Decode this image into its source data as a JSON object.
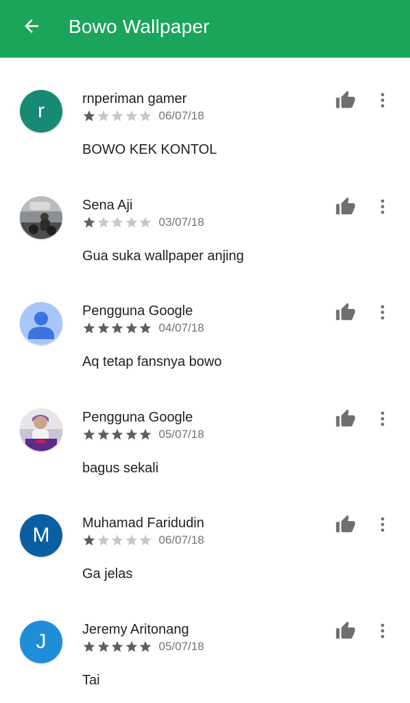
{
  "appbar": {
    "title": "Bowo Wallpaper",
    "back_icon": "arrow-back-icon",
    "color": "#1aa55b"
  },
  "reviews": [
    {
      "author": "rnperiman gamer",
      "date": "06/07/18",
      "rating": 1,
      "text": "BOWO KEK KONTOL",
      "avatar": {
        "type": "letter",
        "letter": "r",
        "color": "#178a73"
      }
    },
    {
      "author": "Sena Aji",
      "date": "03/07/18",
      "rating": 1,
      "text": "Gua suka wallpaper anjing",
      "avatar": {
        "type": "photo",
        "description": "street photo"
      }
    },
    {
      "author": "Pengguna Google",
      "date": "04/07/18",
      "rating": 5,
      "text": "Aq tetap fansnya bowo",
      "avatar": {
        "type": "default-person",
        "color": "#a8c6fa"
      }
    },
    {
      "author": "Pengguna Google",
      "date": "05/07/18",
      "rating": 5,
      "text": "bagus sekali",
      "avatar": {
        "type": "photo",
        "description": "person photo"
      }
    },
    {
      "author": "Muhamad Faridudin",
      "date": "06/07/18",
      "rating": 1,
      "text": "Ga jelas",
      "avatar": {
        "type": "letter",
        "letter": "M",
        "color": "#0b5ea3"
      }
    },
    {
      "author": "Jeremy Aritonang",
      "date": "05/07/18",
      "rating": 5,
      "text": "Tai",
      "avatar": {
        "type": "letter",
        "letter": "J",
        "color": "#1e8ed9"
      }
    }
  ],
  "icons": {
    "thumb": "thumb-up-icon",
    "more": "more-vert-icon",
    "star": "star-icon"
  },
  "colors": {
    "star_filled": "#5f5f5f",
    "star_empty": "#c7c7c7",
    "icon_gray": "#6f6f6f"
  }
}
